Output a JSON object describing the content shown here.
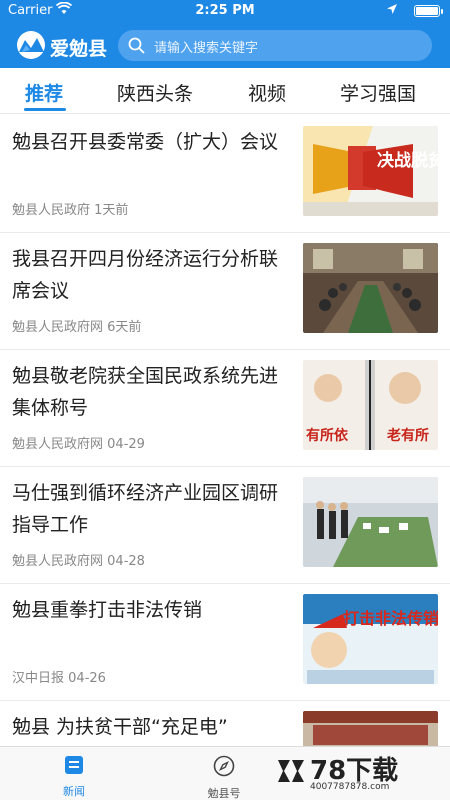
{
  "status_bar": {
    "carrier": "Carrier",
    "time": "2:25 PM"
  },
  "header": {
    "app_name": "爱勉县",
    "search_placeholder": "请输入搜索关键字"
  },
  "tabs": [
    {
      "label": "推荐",
      "active": true
    },
    {
      "label": "陕西头条",
      "active": false
    },
    {
      "label": "视频",
      "active": false
    },
    {
      "label": "学习强国",
      "active": false
    }
  ],
  "news": [
    {
      "title": "勉县召开县委常委（扩大）会议",
      "source": "勉县人民政府",
      "time": "1天前",
      "thumb_text": "决战脱贫"
    },
    {
      "title": "我县召开四月份经济运行分析联席会议",
      "source": "勉县人民政府网",
      "time": "6天前",
      "thumb_text": ""
    },
    {
      "title": "勉县敬老院获全国民政系统先进集体称号",
      "source": "勉县人民政府网",
      "time": "04-29",
      "thumb_text_left": "有所依",
      "thumb_text_right": "老有所"
    },
    {
      "title": "马仕强到循环经济产业园区调研指导工作",
      "source": "勉县人民政府网",
      "time": "04-28",
      "thumb_text": ""
    },
    {
      "title": "勉县重拳打击非法传销",
      "source": "汉中日报",
      "time": "04-26",
      "thumb_text": "打击非法传销"
    },
    {
      "title": "勉县 为扶贫干部“充足电”",
      "source": "",
      "time": "",
      "thumb_text": ""
    }
  ],
  "bottom_nav": [
    {
      "label": "新闻",
      "icon": "news-icon",
      "active": true
    },
    {
      "label": "勉县号",
      "icon": "compass-icon",
      "active": false
    }
  ],
  "watermark": {
    "big": "78下载",
    "small": "4007787878.com"
  },
  "colors": {
    "accent": "#1e88e5"
  }
}
